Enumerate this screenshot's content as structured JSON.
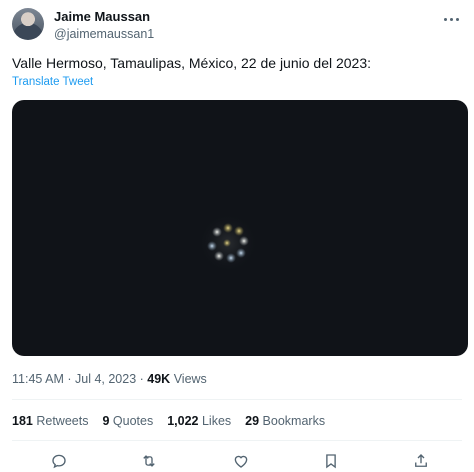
{
  "author": {
    "name": "Jaime Maussan",
    "handle": "@jaimemaussan1"
  },
  "tweet": {
    "text": "Valle Hermoso, Tamaulipas, México, 22 de junio del 2023:",
    "translate_label": "Translate Tweet"
  },
  "meta": {
    "time": "11:45 AM · Jul 4, 2023 · ",
    "views_count": "49K",
    "views_label": "Views"
  },
  "stats": {
    "retweets_count": "181",
    "retweets_label": "Retweets",
    "quotes_count": "9",
    "quotes_label": "Quotes",
    "likes_count": "1,022",
    "likes_label": "Likes",
    "bookmarks_count": "29",
    "bookmarks_label": "Bookmarks"
  },
  "icons": {
    "more": "more-dots-icon",
    "reply": "reply-icon",
    "retweet": "retweet-icon",
    "like": "like-icon",
    "bookmark": "bookmark-icon",
    "share": "share-icon"
  },
  "colors": {
    "link": "#1d9bf0",
    "secondary_text": "#536471",
    "media_background": "#101318"
  }
}
